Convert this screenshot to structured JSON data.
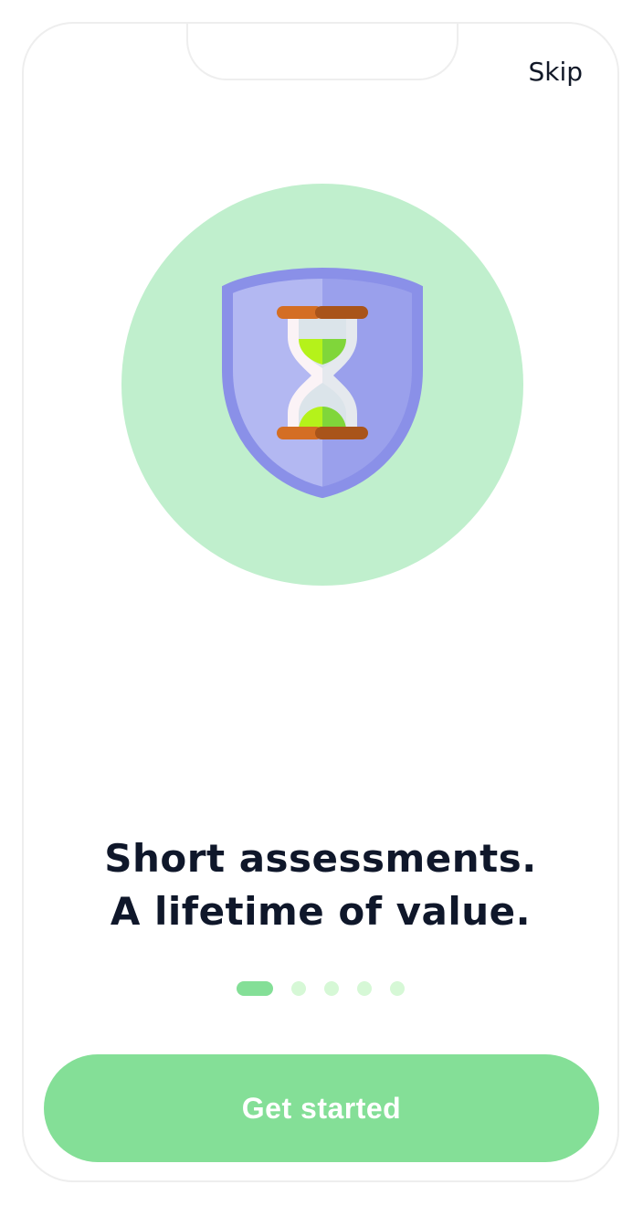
{
  "header": {
    "skip_label": "Skip"
  },
  "hero": {
    "icon": "hourglass-shield-icon",
    "circle_color": "#c0efcd"
  },
  "headline": {
    "line1": "Short assessments.",
    "line2": "A lifetime of value."
  },
  "pagination": {
    "total": 5,
    "active_index": 0,
    "active_color": "#84df97",
    "inactive_color": "#d6f8d6"
  },
  "cta": {
    "label": "Get started",
    "color": "#84df97"
  }
}
